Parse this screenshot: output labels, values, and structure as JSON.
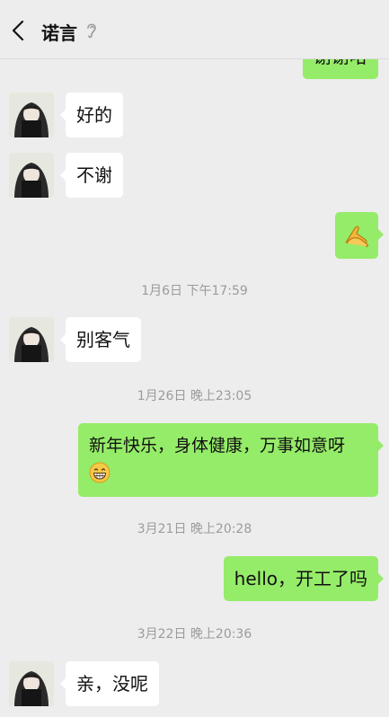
{
  "header": {
    "title": "诺言"
  },
  "messages": {
    "m0": "谢谢哈",
    "m1": "好的",
    "m2": "不谢",
    "m4": "别客气",
    "m5": "新年快乐，身体健康，万事如意呀",
    "m6": "hello，开工了吗",
    "m7": "亲，没呢"
  },
  "timestamps": {
    "t1": "1月6日 下午17:59",
    "t2": "1月26日 晚上23:05",
    "t3": "3月21日 晚上20:28",
    "t4": "3月22日 晚上20:36"
  },
  "icons": {
    "back": "chevron-left-icon",
    "mute": "ear-icon",
    "handshake": "handshake-emoji",
    "grin": "grinning-face-emoji"
  },
  "colors": {
    "sent_bubble": "#95ec69",
    "received_bubble": "#ffffff",
    "background": "#ededed"
  }
}
